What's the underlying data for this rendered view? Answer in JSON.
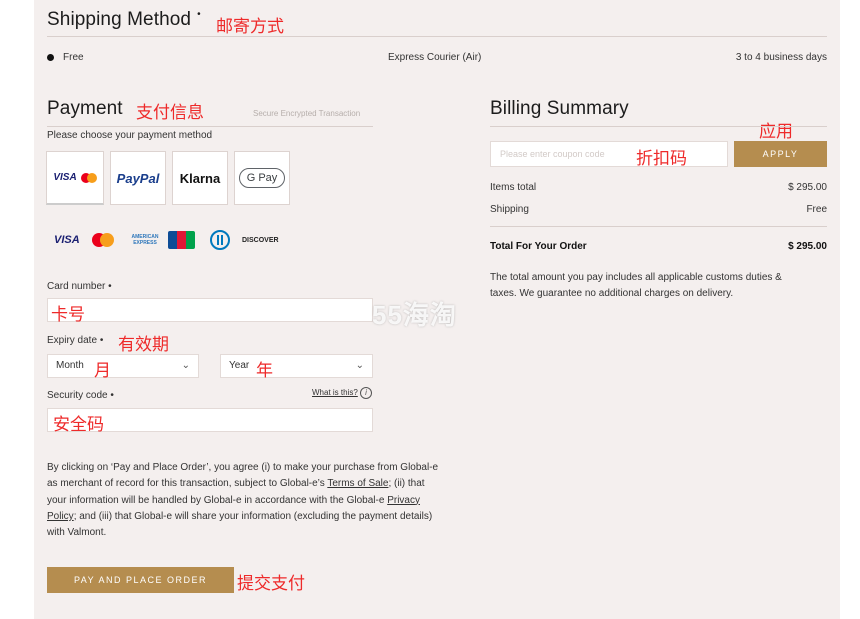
{
  "shipping": {
    "title": "Shipping Method",
    "anno": "邮寄方式",
    "option_price": "Free",
    "option_carrier": "Express Courier (Air)",
    "option_time": "3 to 4 business days"
  },
  "payment": {
    "title": "Payment",
    "anno": "支付信息",
    "secure_note": "Secure Encrypted Transaction",
    "choose_label": "Please choose your payment method",
    "methods": [
      "VISA",
      "PayPal",
      "Klarna",
      "G Pay"
    ],
    "card_brands": [
      "VISA",
      "Mastercard",
      "AMERICAN EXPRESS",
      "JCB",
      "Diners Club",
      "DISCOVER"
    ],
    "card_number_label": "Card number",
    "card_number_anno": "卡号",
    "expiry_label": "Expiry date",
    "expiry_anno": "有效期",
    "month_placeholder": "Month",
    "month_anno": "月",
    "year_placeholder": "Year",
    "year_anno": "年",
    "security_label": "Security code",
    "security_anno": "安全码",
    "whats_this": "What is this?",
    "required_mark": "•"
  },
  "legal": {
    "p1": "By clicking on ‘Pay and Place Order’, you agree (i) to make your purchase from Global-e as merchant of record for this transaction, subject to Global-e’s ",
    "terms_link": "Terms of Sale",
    "p2": "; (ii) that your information will be handled by Global-e in accordance with the Global-e ",
    "privacy_link": "Privacy Policy",
    "p3": "; and (iii) that Global-e will share your information (excluding the payment details) with Valmont."
  },
  "order_button": {
    "label": "PAY AND PLACE ORDER",
    "anno": "提交支付"
  },
  "billing": {
    "title": "Billing Summary",
    "apply_anno": "应用",
    "coupon_placeholder": "Please enter coupon code",
    "coupon_anno": "折扣码",
    "apply_label": "APPLY",
    "items_total_label": "Items total",
    "items_total_value": "$ 295.00",
    "shipping_label": "Shipping",
    "shipping_value": "Free",
    "order_total_label": "Total For Your Order",
    "order_total_value": "$ 295.00",
    "note": "The total amount you pay includes all applicable customs duties & taxes. We guarantee no additional charges on delivery."
  },
  "watermark": "55海淘",
  "colors": {
    "accent": "#b58d4f",
    "annotation": "#ee2a2a",
    "panel": "#f4efee"
  }
}
